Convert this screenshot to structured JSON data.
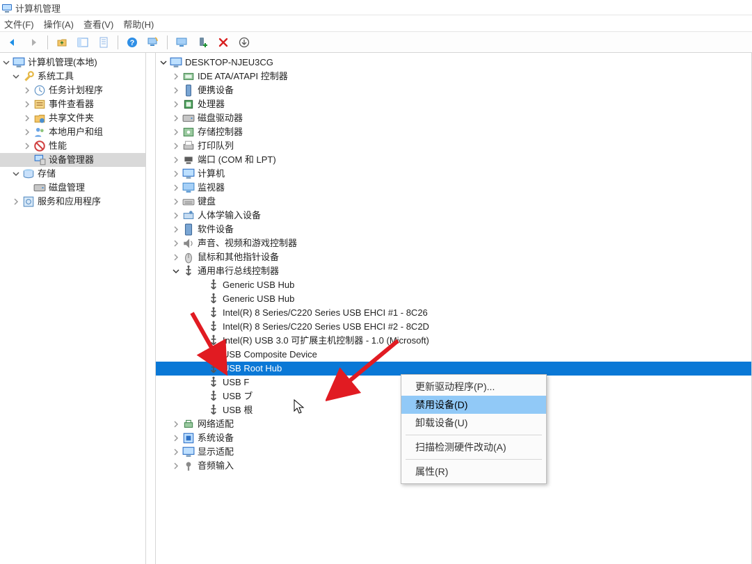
{
  "window": {
    "title": "计算机管理"
  },
  "menu": {
    "file": "文件(F)",
    "action": "操作(A)",
    "view": "查看(V)",
    "help": "帮助(H)"
  },
  "toolbar_icons": {
    "back": "back-arrow",
    "forward": "forward-arrow",
    "up": "up-folder",
    "show_hide": "panel-toggle",
    "properties": "sheet",
    "help": "help",
    "refresh": "monitor-refresh",
    "scan": "monitor",
    "add": "device-add",
    "delete": "delete-x",
    "install": "install-down"
  },
  "left_tree": {
    "root": "计算机管理(本地)",
    "system_tools": {
      "label": "系统工具",
      "children": {
        "task_scheduler": "任务计划程序",
        "event_viewer": "事件查看器",
        "shared_folders": "共享文件夹",
        "local_users": "本地用户和组",
        "performance": "性能",
        "device_manager": "设备管理器"
      }
    },
    "storage": {
      "label": "存储",
      "children": {
        "disk_mgmt": "磁盘管理"
      }
    },
    "services_apps": "服务和应用程序"
  },
  "right_tree": {
    "root": "DESKTOP-NJEU3CG",
    "categories": {
      "ide": "IDE ATA/ATAPI 控制器",
      "portable": "便携设备",
      "processor": "处理器",
      "disk_drives": "磁盘驱动器",
      "storage_ctrl": "存储控制器",
      "print_queues": "打印队列",
      "ports": "端口 (COM 和 LPT)",
      "computer": "计算机",
      "monitors": "监视器",
      "keyboards": "键盘",
      "hid": "人体学输入设备",
      "software_devices": "软件设备",
      "sound": "声音、视频和游戏控制器",
      "mice": "鼠标和其他指针设备",
      "usb": {
        "label": "通用串行总线控制器",
        "children": {
          "hub1": "Generic USB Hub",
          "hub2": "Generic USB Hub",
          "ehci1": "Intel(R) 8 Series/C220 Series USB EHCI #1 - 8C26",
          "ehci2": "Intel(R) 8 Series/C220 Series USB EHCI #2 - 8C2D",
          "xhci": "Intel(R) USB 3.0 可扩展主机控制器 - 1.0 (Microsoft)",
          "composite": "USB Composite Device",
          "root_hub": "USB Root Hub",
          "usb_f": "USB F",
          "usb7": "USB ブ",
          "usb_t": "USB 根"
        }
      },
      "network": "网络适配",
      "system_dev": "系统设备",
      "display": "显示适配",
      "audio_in": "音频输入"
    }
  },
  "context_menu": {
    "update_driver": "更新驱动程序(P)...",
    "disable_device": "禁用设备(D)",
    "uninstall_device": "卸载设备(U)",
    "scan_hw": "扫描检测硬件改动(A)",
    "properties": "属性(R)"
  },
  "colors": {
    "selection_gray": "#d9d9d9",
    "selection_blue": "#0a78d6",
    "menu_highlight": "#91c9f7",
    "arrow_red": "#e11b22"
  }
}
